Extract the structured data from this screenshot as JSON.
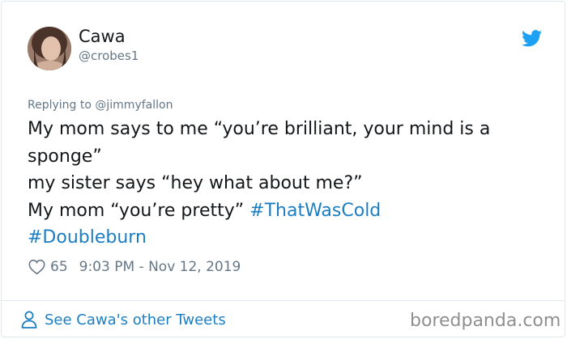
{
  "author": {
    "display_name": "Cawa",
    "handle": "@crobes1"
  },
  "reply": {
    "prefix": "Replying to ",
    "mention": "@jimmyfallon"
  },
  "tweet": {
    "text": "My mom says to me “you’re brilliant, your mind is a sponge”\nmy sister says “hey what about me?”\nMy mom “you’re pretty” ",
    "hashtag_1": "#ThatWasCold",
    "hashtag_2": "#Doubleburn"
  },
  "meta": {
    "likes": "65",
    "timestamp": "9:03 PM - Nov 12, 2019"
  },
  "footer": {
    "see_other_label": "See Cawa's other Tweets",
    "watermark": "boredpanda.com"
  },
  "icons": {
    "brand": "twitter-bird-icon",
    "like": "heart-icon",
    "profile": "person-icon"
  },
  "colors": {
    "link": "#1b7ec2",
    "twitter_blue": "#1da1f2",
    "muted": "#657786",
    "border": "#e1e8ed"
  }
}
